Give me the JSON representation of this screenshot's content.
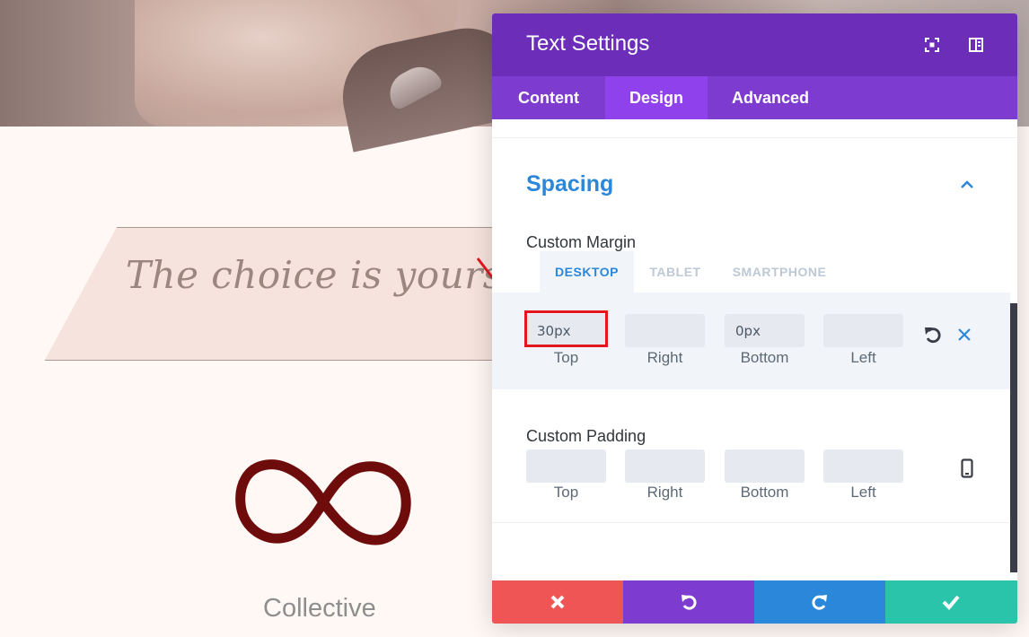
{
  "background_page": {
    "banner_text": "The choice is yours",
    "caption": "Collective"
  },
  "panel": {
    "title": "Text Settings",
    "header_icons": [
      "expand-icon",
      "sidebar-toggle-icon"
    ],
    "tabs": [
      {
        "label": "Content",
        "active": false
      },
      {
        "label": "Design",
        "active": true
      },
      {
        "label": "Advanced",
        "active": false
      }
    ],
    "section": {
      "title": "Spacing",
      "expanded": true
    },
    "custom_margin": {
      "label": "Custom Margin",
      "device_tabs": [
        {
          "label": "DESKTOP",
          "active": true
        },
        {
          "label": "TABLET",
          "active": false
        },
        {
          "label": "SMARTPHONE",
          "active": false
        }
      ],
      "fields": [
        {
          "label": "Top",
          "value": "30px"
        },
        {
          "label": "Right",
          "value": ""
        },
        {
          "label": "Bottom",
          "value": "0px"
        },
        {
          "label": "Left",
          "value": ""
        }
      ]
    },
    "custom_padding": {
      "label": "Custom Padding",
      "fields": [
        {
          "label": "Top",
          "value": ""
        },
        {
          "label": "Right",
          "value": ""
        },
        {
          "label": "Bottom",
          "value": ""
        },
        {
          "label": "Left",
          "value": ""
        }
      ]
    },
    "footer_buttons": [
      {
        "name": "discard",
        "icon": "close-icon",
        "color": "#ef5555"
      },
      {
        "name": "undo",
        "icon": "undo-icon",
        "color": "#7e3bd0"
      },
      {
        "name": "redo",
        "icon": "redo-icon",
        "color": "#2b87da"
      },
      {
        "name": "save",
        "icon": "check-icon",
        "color": "#29c4a9"
      }
    ]
  },
  "colors": {
    "header": "#6c2eb9",
    "tabs_bar": "#7e3bd0",
    "active_tab": "#8f42ec",
    "accent_blue": "#2b87da",
    "highlight_red": "#e3171f"
  }
}
